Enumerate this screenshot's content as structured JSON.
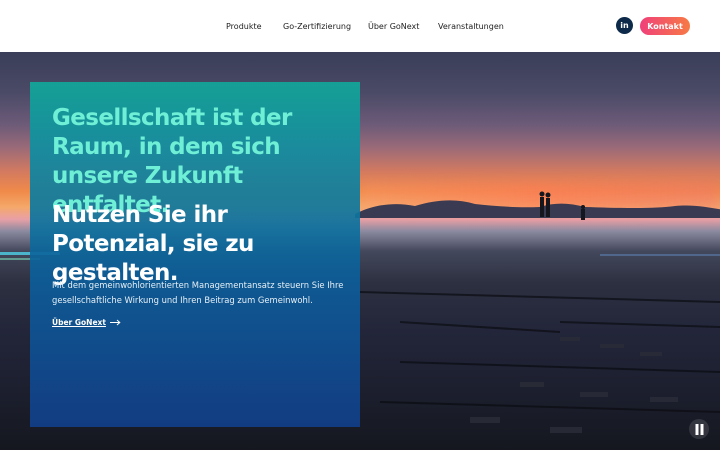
{
  "nav": {
    "items": [
      {
        "label": "Produkte"
      },
      {
        "label": "Go-Zertifizierung"
      },
      {
        "label": "Über GoNext"
      },
      {
        "label": "Veranstaltungen"
      }
    ]
  },
  "header": {
    "linkedin_icon": "linkedin-icon",
    "linkedin_glyph": "in",
    "contact_label": "Kontakt"
  },
  "hero": {
    "headline_1": "Gesellschaft ist der Raum, in dem sich unsere Zukunft entfaltet.",
    "headline_2": "Nutzen Sie ihr Potenzial, sie zu gestalten.",
    "body": "Mit dem gemeinwohlorientierten Managementansatz steuern Sie Ihre gesellschaftliche Wirkung und Ihren Beitrag zum Gemeinwohl.",
    "cta_label": "Über GoNext",
    "cta_icon": "arrow-right-icon",
    "pause_icon": "pause-icon"
  },
  "colors": {
    "accent_teal": "#6ff0d6",
    "contact_gradient_start": "#f0407a",
    "contact_gradient_end": "#f77a45",
    "linkedin_bg": "#0d2a4a"
  }
}
